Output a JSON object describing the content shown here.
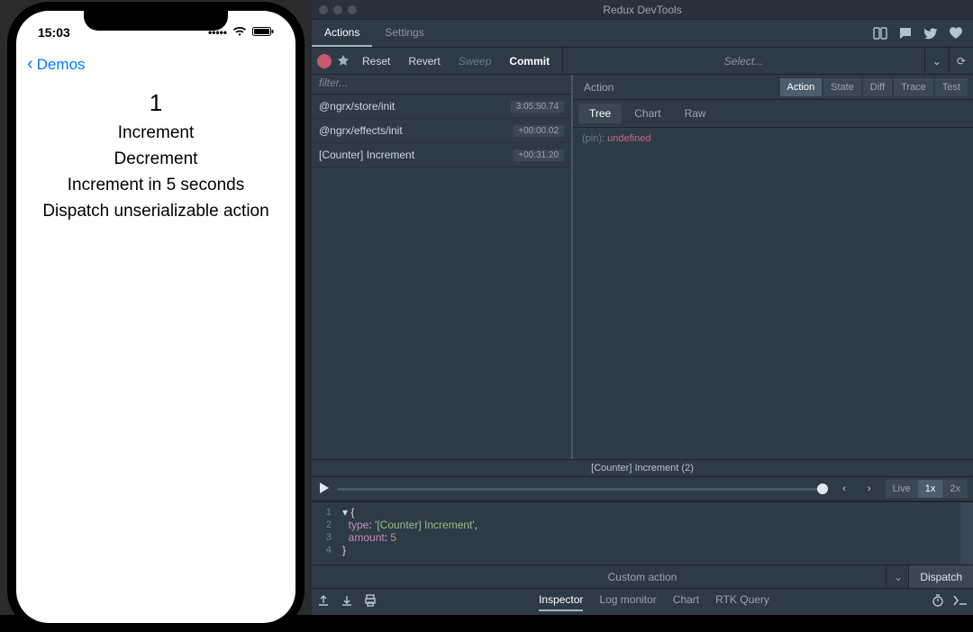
{
  "phone": {
    "time": "15:03",
    "back_label": "Demos",
    "counter_value": "1",
    "buttons": [
      {
        "label": "Increment"
      },
      {
        "label": "Decrement"
      },
      {
        "label": "Increment in 5 seconds"
      },
      {
        "label": "Dispatch unserializable action"
      }
    ]
  },
  "devtools": {
    "window_title": "Redux DevTools",
    "nav_tabs": {
      "actions": "Actions",
      "settings": "Settings"
    },
    "toolbar": {
      "reset": "Reset",
      "revert": "Revert",
      "sweep": "Sweep",
      "commit": "Commit",
      "select_placeholder": "Select..."
    },
    "filter_placeholder": "filter...",
    "actions": [
      {
        "name": "@ngrx/store/init",
        "ts": "3:05:50.74"
      },
      {
        "name": "@ngrx/effects/init",
        "ts": "+00:00.02"
      },
      {
        "name": "[Counter] Increment",
        "ts": "+00:31.20"
      }
    ],
    "detail": {
      "title": "Action",
      "view_tabs": {
        "action": "Action",
        "state": "State",
        "diff": "Diff",
        "trace": "Trace",
        "test": "Test"
      },
      "sub_tabs": {
        "tree": "Tree",
        "chart": "Chart",
        "raw": "Raw"
      },
      "pin_line": {
        "label": "(pin):",
        "value": "undefined"
      }
    },
    "playbar": {
      "label": "[Counter] Increment (2)",
      "live": "Live",
      "x1": "1x",
      "x2": "2x"
    },
    "editor": {
      "lines": [
        "1",
        "2",
        "3",
        "4"
      ],
      "code": {
        "open": "{",
        "type_key": "type",
        "type_val": "'[Counter] Increment'",
        "comma": ",",
        "amount_key": "amount",
        "amount_val": "5",
        "close": "}"
      }
    },
    "custom_action_label": "Custom action",
    "dispatch_label": "Dispatch",
    "bottom_tabs": {
      "inspector": "Inspector",
      "log": "Log monitor",
      "chart": "Chart",
      "rtk": "RTK Query"
    }
  }
}
